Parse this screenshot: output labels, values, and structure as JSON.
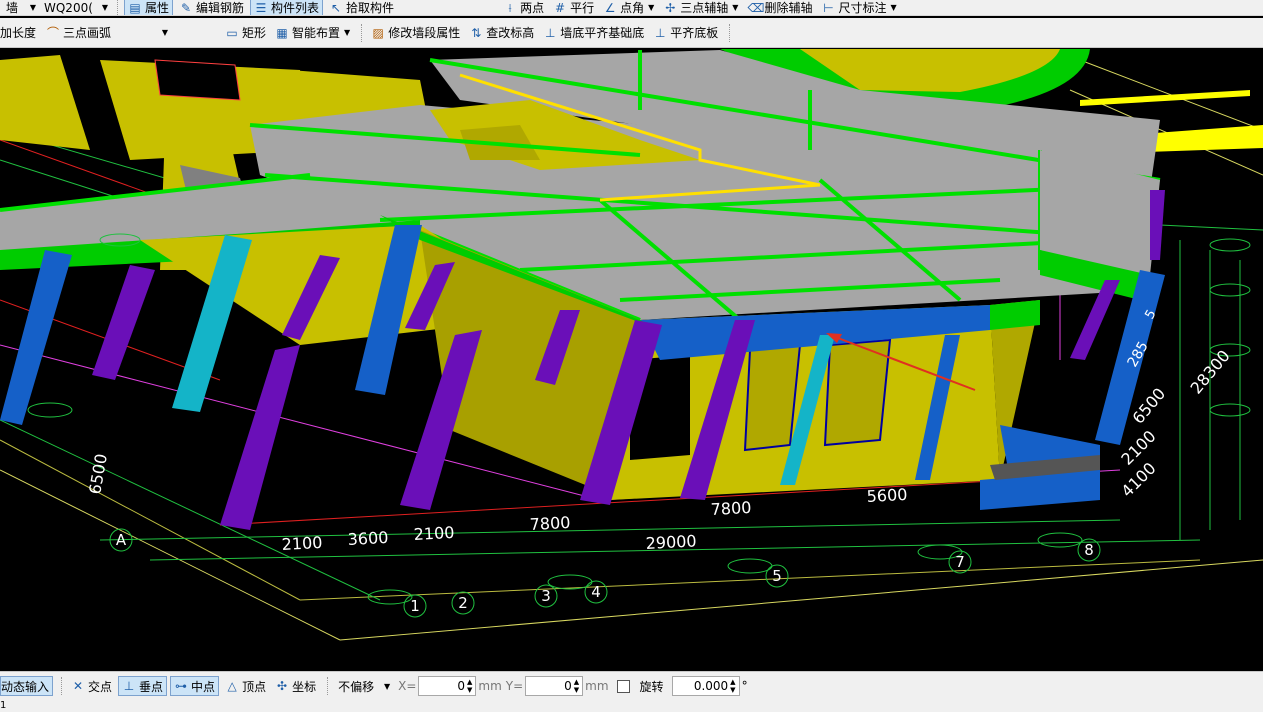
{
  "toolbar1": {
    "wall_label": "墙",
    "wall_type": "WQ200(",
    "properties": "属性",
    "edit_rebar": "编辑钢筋",
    "component_list": "构件列表",
    "pick_component": "拾取构件",
    "two_points": "两点",
    "parallel": "平行",
    "point_angle": "点角",
    "three_point_axis": "三点辅轴",
    "delete_axis": "删除辅轴",
    "dimension": "尺寸标注"
  },
  "toolbar2": {
    "extend_length": "加长度",
    "three_point_arc": "三点画弧",
    "rectangle": "矩形",
    "smart_layout": "智能布置",
    "modify_wall_segment": "修改墙段属性",
    "check_elevation": "查改标高",
    "wall_bottom_align": "墙底平齐基础底",
    "align_slab_bottom": "平齐底板"
  },
  "statusbar": {
    "dynamic_input": "动态输入",
    "intersection": "交点",
    "perpendicular": "垂点",
    "midpoint": "中点",
    "vertex": "顶点",
    "coordinate": "坐标",
    "offset_mode": "不偏移",
    "x_label": "X=",
    "x_value": "0",
    "y_label": "Y=",
    "y_value": "0",
    "unit": "mm",
    "rotate_label": "旋转",
    "rotate_value": "0.000",
    "degree": "°"
  },
  "bottom_text": "1",
  "drawing": {
    "dims_bottom": [
      "2100",
      "3600",
      "2100",
      "7800",
      "29000",
      "7800",
      "5600"
    ],
    "dims_right": [
      "285",
      "6500",
      "28300",
      "2100",
      "4100",
      "5"
    ],
    "dim_left": "6500",
    "axis_bubbles": [
      "A",
      "1",
      "2",
      "3",
      "4",
      "5",
      "7",
      "8"
    ],
    "colors": {
      "slab": "#a6a6a6",
      "beam": "#00cc00",
      "wall": "#c8c000",
      "column_purple": "#6a0fb8",
      "column_blue": "#1560c8",
      "column_cyan": "#14b4c8",
      "arrow": "#e03020"
    }
  }
}
